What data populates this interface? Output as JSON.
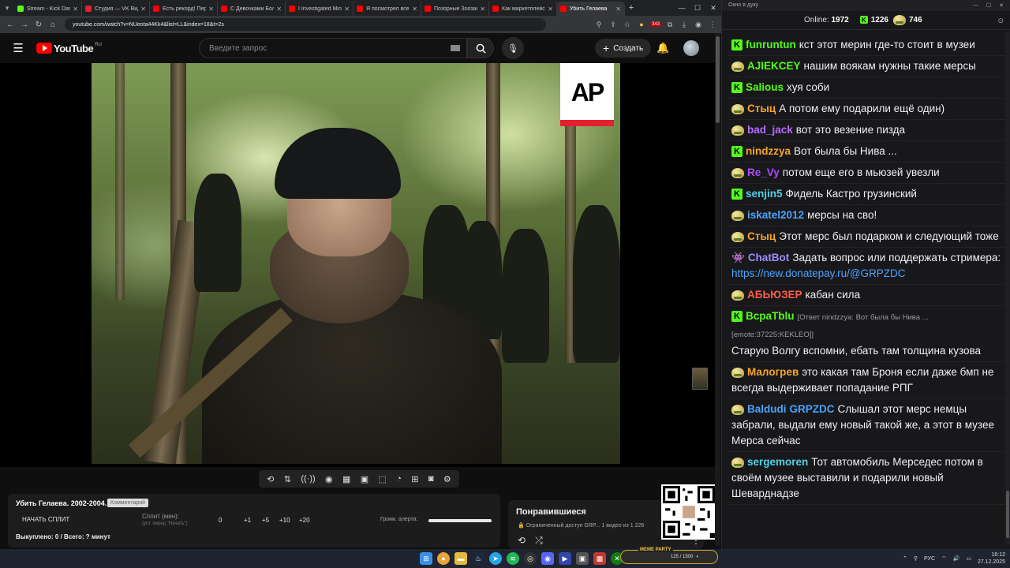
{
  "browser": {
    "tabs": [
      {
        "title": "Stream - Kick Dash",
        "color": "#53fc18"
      },
      {
        "title": "Студия — VK Вид",
        "color": "#e4202e"
      },
      {
        "title": "Есть рекорд! Пере",
        "color": "#ff0000"
      },
      {
        "title": "С Девочками Бол",
        "color": "#ff0000"
      },
      {
        "title": "I Investigated Min",
        "color": "#ff0000"
      },
      {
        "title": "Я посмотрел все с",
        "color": "#ff0000"
      },
      {
        "title": "Позорные Зоозащ",
        "color": "#ff0000"
      },
      {
        "title": "Как маркетплейс",
        "color": "#ff0000"
      },
      {
        "title": "Убить Гелаева",
        "color": "#ff0000",
        "active": true
      }
    ],
    "url": "youtube.com/watch?v=NUeota44Kk4&list=LL&index=18&t=2s",
    "ext_badge": "343"
  },
  "youtube": {
    "logo_text": "YouTube",
    "region": "RU",
    "search_placeholder": "Введите запрос",
    "create_label": "Создать"
  },
  "video": {
    "watermark": "AP"
  },
  "split": {
    "title": "Убить Гелаева. 2002-2004.",
    "badge": "Комментарий",
    "start_label": "НАЧАТЬ СПЛИТ",
    "split_label": "Сплит (мин):",
    "split_sub": "(уст. перед \"Начать\")",
    "values": [
      "0",
      "+1",
      "+5",
      "+10",
      "+20"
    ],
    "alert_label": "Громк. алерта:",
    "alert_level": 1.0,
    "bought": "Выкуплено: 0 / Всего: ? минут"
  },
  "liked": {
    "title": "Понравившиеся",
    "meta": "Ограниченный доступ GRP...   1 видео из 1 226"
  },
  "chat": {
    "window_title": "Окно в дуку",
    "online_label": "Online:",
    "online_count": "1972",
    "kick_count": "1226",
    "pepe_count": "746",
    "messages": [
      {
        "user": "funruntun",
        "color": "#53fc18",
        "badge": "kick",
        "text": "кст этот мерин где-то стоит в музеи"
      },
      {
        "user": "AJIEKCEY",
        "color": "#53fc18",
        "badge": "pepe",
        "text": "нашим воякам нужны такие мерсы"
      },
      {
        "user": "Salious",
        "color": "#53fc18",
        "badge": "kick",
        "text": "хуя соби"
      },
      {
        "user": "Стыц",
        "color": "#f5a623",
        "badge": "pepe",
        "text": "А потом ему подарили ещё один)"
      },
      {
        "user": "bad_jack",
        "color": "#b56cff",
        "badge": "pepe",
        "text": "вот это везение пизда"
      },
      {
        "user": "nindzzya",
        "color": "#f5a623",
        "badge": "kick",
        "text": "Вот была бы Нива ..."
      },
      {
        "user": "Re_Vy",
        "color": "#a94bff",
        "badge": "pepe",
        "text": "потом еще его в мьюзей увезли"
      },
      {
        "user": "senjin5",
        "color": "#4fd1e6",
        "badge": "kick",
        "text": "Фидель Кастро грузинский"
      },
      {
        "user": "iskatel2012",
        "color": "#4aa3ff",
        "badge": "pepe",
        "text": "мерсы на сво!"
      },
      {
        "user": "Стыц",
        "color": "#f5a623",
        "badge": "pepe",
        "text": "Этот мерс был подарком и следующий тоже"
      },
      {
        "user": "ChatBot",
        "color": "#9b8cff",
        "badge": "bot",
        "text": "Задать вопрос или поддержать стримера: ",
        "link": "https://new.donatepay.ru/@GRPZDC"
      },
      {
        "user": "АБЬЮЗЕР",
        "color": "#ff5a4a",
        "badge": "pepe",
        "text": "кабан сила"
      },
      {
        "user": "ВсраТblu",
        "color": "#53fc18",
        "badge": "kick",
        "reply": "[Ответ nindzzya: Вот была бы Нива ... [emote:37225:KEKLEO]]",
        "text": "Старую Волгу вспомни, ебать там толщина кузова"
      },
      {
        "user": "Малогрев",
        "color": "#f5a623",
        "badge": "pepe",
        "text": "это какая там Броня если даже бмп не всегда выдерживает попадание РПГ"
      },
      {
        "user": "Baldudi",
        "color": "#4aa3ff",
        "badge": "pepe",
        "mention": "GRPZDC",
        "text": "Слышал этот мерс немцы забрали, выдали ему новый такой же, а этот в музее Мерса сейчас"
      },
      {
        "user": "sergemoren",
        "color": "#4fd1e6",
        "badge": "pepe",
        "text": "Тот автомобиль Мерседес потом в своём музее выставили и подарили новый Шеварднадзе"
      }
    ]
  },
  "taskbar": {
    "meme_party_label": "MEME PARTY",
    "meme_party_value": "125 / 1500",
    "lang": "РУС",
    "time": "16:12",
    "date": "27.12.2025"
  }
}
